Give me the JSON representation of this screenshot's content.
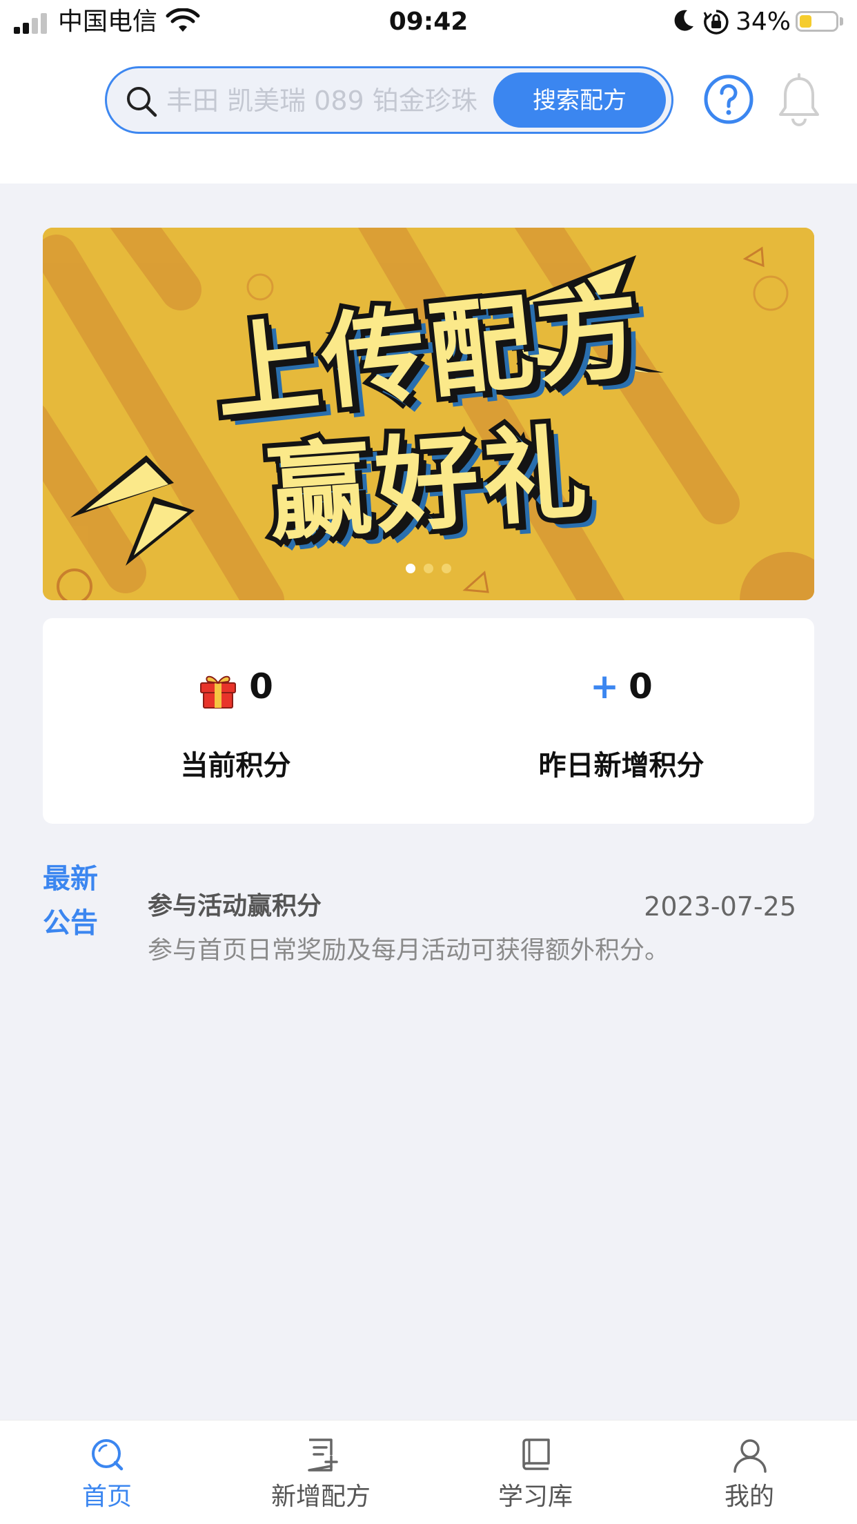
{
  "status_bar": {
    "carrier": "中国电信",
    "time": "09:42",
    "battery_percent": "34%",
    "battery_level": 0.34,
    "battery_color": "#f5cc2d"
  },
  "header": {
    "search": {
      "placeholder": "丰田 凯美瑞 089 铂金珍珠",
      "button_label": "搜索配方"
    },
    "help_icon": "question-circle-icon",
    "bell_icon": "bell-icon"
  },
  "banner": {
    "line1": "上传配方",
    "line2": "赢好礼",
    "slide_count": 3,
    "active_slide": 0,
    "background_color": "#e6b93b"
  },
  "points": {
    "current": {
      "icon": "gift-icon",
      "value": "0",
      "label": "当前积分"
    },
    "yesterday": {
      "prefix": "+",
      "value": "0",
      "label": "昨日新增积分"
    }
  },
  "announcement": {
    "tag": "最新公告",
    "title": "参与活动赢积分",
    "date": "2023-07-25",
    "description": "参与首页日常奖励及每月活动可获得额外积分。"
  },
  "tab_bar": {
    "items": [
      {
        "label": "首页",
        "icon": "home-search-icon",
        "active": true
      },
      {
        "label": "新增配方",
        "icon": "add-document-icon",
        "active": false
      },
      {
        "label": "学习库",
        "icon": "book-icon",
        "active": false
      },
      {
        "label": "我的",
        "icon": "user-icon",
        "active": false
      }
    ]
  },
  "colors": {
    "accent": "#3b86f0",
    "page_background": "#f1f2f7"
  }
}
